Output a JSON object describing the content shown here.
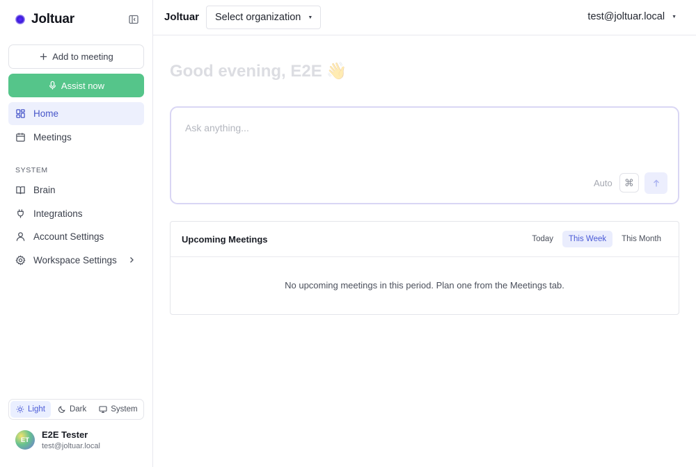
{
  "brand": {
    "name": "Joltuar"
  },
  "sidebar": {
    "add_meeting_label": "Add to meeting",
    "assist_now_label": "Assist now",
    "nav": [
      {
        "label": "Home",
        "icon": "grid-icon"
      },
      {
        "label": "Meetings",
        "icon": "calendar-icon"
      }
    ],
    "system_section_label": "SYSTEM",
    "system_nav": [
      {
        "label": "Brain",
        "icon": "book-icon"
      },
      {
        "label": "Integrations",
        "icon": "plug-icon"
      },
      {
        "label": "Account Settings",
        "icon": "user-icon"
      },
      {
        "label": "Workspace Settings",
        "icon": "gear-icon"
      }
    ],
    "theme": {
      "light": "Light",
      "dark": "Dark",
      "system": "System",
      "selected": "Light"
    },
    "user": {
      "initials": "ET",
      "name": "E2E Tester",
      "email": "test@joltuar.local"
    }
  },
  "topbar": {
    "brand": "Joltuar",
    "org_select": "Select organization",
    "account": "test@joltuar.local"
  },
  "main": {
    "greeting": "Good evening, E2E",
    "greeting_emoji": "👋",
    "prompt_placeholder": "Ask anything...",
    "mode_label": "Auto",
    "cmd_glyph": "⌘",
    "upcoming": {
      "title": "Upcoming Meetings",
      "tabs": [
        "Today",
        "This Week",
        "This Month"
      ],
      "selected_tab": "This Week",
      "empty_message": "No upcoming meetings in this period. Plan one from the Meetings tab."
    }
  },
  "colors": {
    "accent": "#4a5ad6",
    "assist_green": "#55c58a",
    "active_nav_bg": "#edf0fd"
  }
}
